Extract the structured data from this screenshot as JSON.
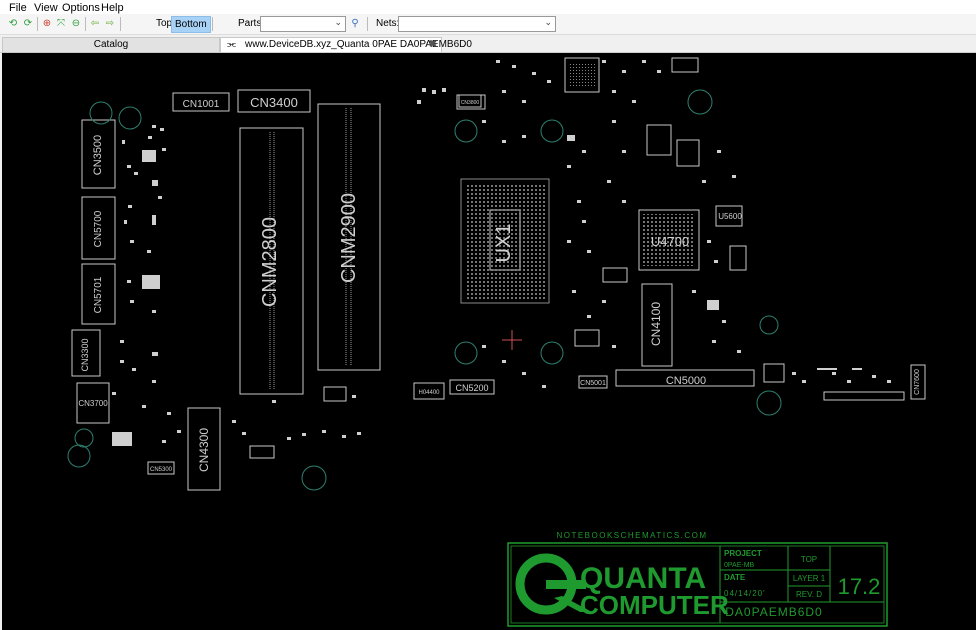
{
  "menu": {
    "file": "File",
    "view": "View",
    "options": "Options",
    "help": "Help"
  },
  "toolbar": {
    "top_label": "Top",
    "bottom_label": "Bottom",
    "parts_label": "Parts:",
    "parts_value": "",
    "nets_label": "Nets:",
    "nets_value": ""
  },
  "tabs": {
    "catalog": "Catalog",
    "board": "www.DeviceDB.xyz_Quanta 0PAE DA0PAEMB6D0"
  },
  "board_labels": {
    "cn1001": "CN1001",
    "cn3400": "CN3400",
    "cn3500": "CN3500",
    "cn5700": "CN5700",
    "cn5701": "CN5701",
    "cn3300": "CN3300",
    "cn3700": "CN3700",
    "cnm2800": "CNM2800",
    "cnm2900": "CNM2900",
    "cn4300": "CN4300",
    "ux1": "UX1",
    "u4700": "U4700",
    "u5600": "U5600",
    "cn4100": "CN4100",
    "cn5000": "CN5000",
    "cn5001": "CN5001",
    "cn5200": "CN5200",
    "h4400": "H04400",
    "cn7600": "CN7600",
    "cn3800": "CN3800",
    "cn5300": "CN5300"
  },
  "title_block": {
    "website": "NOTEBOOKSCHEMATICS.COM",
    "company_line1": "QUANTA",
    "company_line2": "COMPUTER",
    "project_label": "PROJECT",
    "project_value": "0PAE-MB",
    "date_label": "DATE",
    "date_value": "04/14/20'",
    "side_label": "TOP",
    "layer_label": "LAYER 1",
    "rev_label": "REV. D",
    "part_number": "DA0PAEMB6D0",
    "version": "17.2"
  },
  "colors": {
    "pcb_outline": "#c8c8c8",
    "silkscreen_green": "#1f9a2e",
    "board_bg": "#000000",
    "active_toggle": "#a7d2f5"
  }
}
